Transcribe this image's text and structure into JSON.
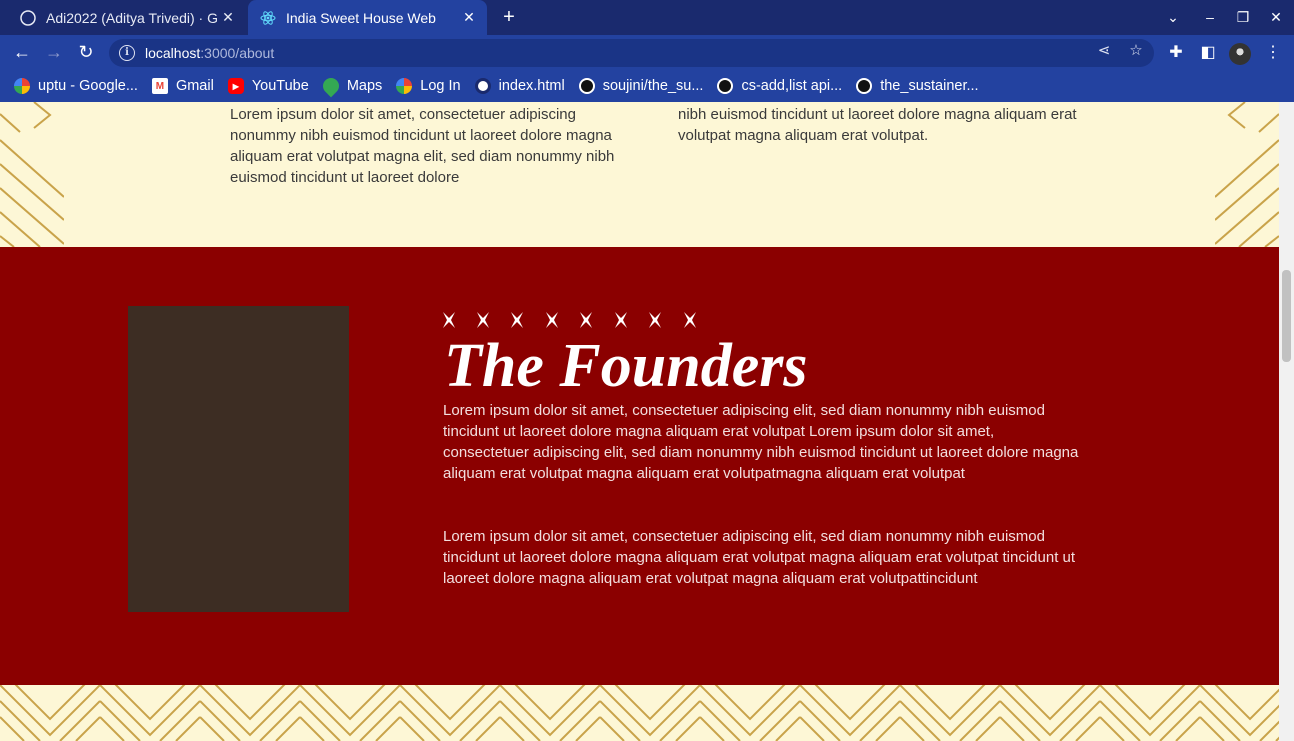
{
  "browser": {
    "tabs": [
      {
        "title": "Adi2022 (Aditya Trivedi) · G",
        "icon": "github-icon",
        "active": false
      },
      {
        "title": "India Sweet House Web",
        "icon": "react-icon",
        "active": true
      }
    ],
    "new_tab_label": "+",
    "url_host": "localhost",
    "url_path": ":3000/about",
    "bookmarks": [
      {
        "label": "uptu - Google...",
        "icon": "google-icon"
      },
      {
        "label": "Gmail",
        "icon": "gmail-icon"
      },
      {
        "label": "YouTube",
        "icon": "youtube-icon"
      },
      {
        "label": "Maps",
        "icon": "maps-icon"
      },
      {
        "label": "Log In",
        "icon": "google-icon"
      },
      {
        "label": "index.html",
        "icon": "globe-icon"
      },
      {
        "label": "soujini/the_su...",
        "icon": "github-icon"
      },
      {
        "label": "cs-add,list api...",
        "icon": "github-icon"
      },
      {
        "label": "the_sustainer...",
        "icon": "github-icon"
      }
    ]
  },
  "top_section": {
    "left_text": "Lorem ipsum dolor sit amet, consectetuer adipiscing nonummy nibh euismod tincidunt ut laoreet dolore magna aliquam erat volutpat magna elit, sed diam nonummy nibh euismod tincidunt ut laoreet dolore",
    "right_text": "nibh euismod tincidunt ut laoreet dolore magna aliquam erat volutpat magna aliquam erat volutpat."
  },
  "founders": {
    "stars": "✖ ✖ ✖ ✖ ✖ ✖ ✖ ✖",
    "title": "The Founders",
    "paragraph1": "Lorem ipsum dolor sit amet, consectetuer adipiscing elit, sed diam nonummy nibh euismod tincidunt ut laoreet dolore magna aliquam erat volutpat Lorem ipsum dolor sit amet, consectetuer adipiscing elit, sed diam nonummy nibh euismod tincidunt ut laoreet dolore magna aliquam erat volutpat magna aliquam erat volutpatmagna aliquam erat volutpat",
    "paragraph2": "Lorem ipsum dolor sit amet, consectetuer adipiscing elit, sed diam nonummy nibh euismod tincidunt ut laoreet dolore magna aliquam erat volutpat magna aliquam erat volutpat tincidunt ut laoreet dolore magna aliquam erat volutpat magna aliquam erat volutpattincidunt"
  },
  "colors": {
    "maroon": "#8b0000",
    "cream": "#fdf7d6",
    "pattern_gold": "#c9a34a",
    "photo_placeholder": "#3d2d23"
  }
}
